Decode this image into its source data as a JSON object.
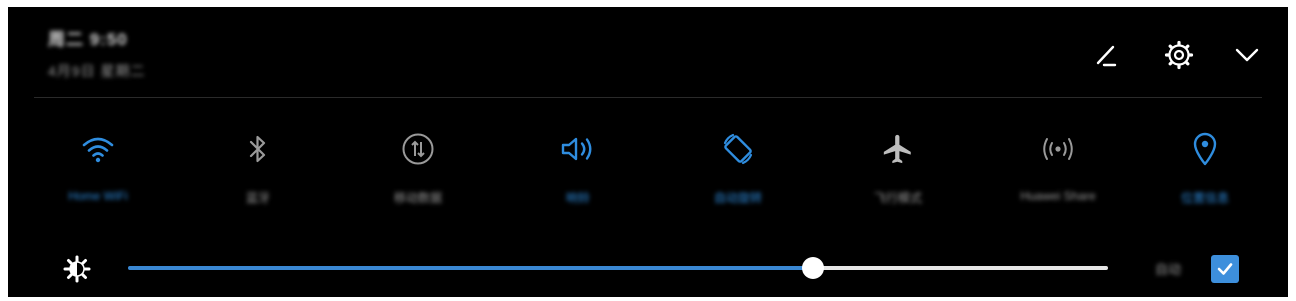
{
  "header": {
    "time": "周二 9:50",
    "date": "4月9日 星期二",
    "edit_icon": "pencil-icon",
    "settings_icon": "gear-icon",
    "collapse_icon": "chevron-down-icon"
  },
  "toggles": [
    {
      "label": "Home WiFi",
      "icon": "wifi-icon",
      "state": "on"
    },
    {
      "label": "蓝牙",
      "icon": "bluetooth-icon",
      "state": "off"
    },
    {
      "label": "移动数据",
      "icon": "mobile-data-icon",
      "state": "off"
    },
    {
      "label": "响铃",
      "icon": "volume-icon",
      "state": "on"
    },
    {
      "label": "自动旋转",
      "icon": "auto-rotate-icon",
      "state": "on"
    },
    {
      "label": "飞行模式",
      "icon": "airplane-icon",
      "state": "off"
    },
    {
      "label": "Huawei Share",
      "icon": "wireless-share-icon",
      "state": "off"
    },
    {
      "label": "位置信息",
      "icon": "location-icon",
      "state": "on"
    }
  ],
  "brightness": {
    "icon": "brightness-icon",
    "level": 0.7,
    "auto_label": "自动",
    "auto_checked": true
  },
  "colors": {
    "accent": "#2f8ddf",
    "inactive": "#9a9a9a",
    "background": "#000000"
  }
}
